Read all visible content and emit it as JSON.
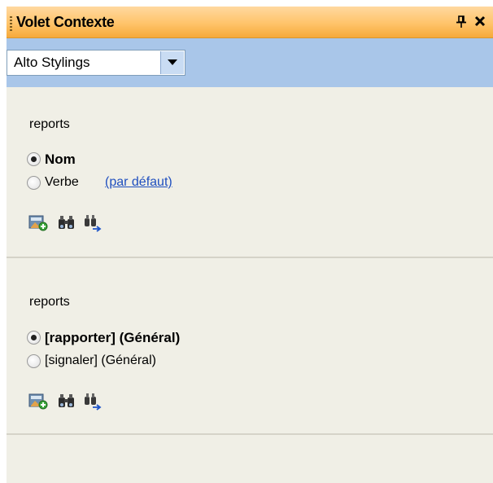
{
  "panel": {
    "title": "Volet Contexte",
    "pin_icon": "pin-icon",
    "close_icon": "close-icon"
  },
  "toolbar": {
    "dropdown_value": "Alto Stylings"
  },
  "sections": [
    {
      "word": "reports",
      "options": [
        {
          "label": "Nom",
          "selected": true
        },
        {
          "label": "Verbe",
          "selected": false,
          "link": "(par défaut)"
        }
      ],
      "icons": [
        "add-entry-icon",
        "binoculars-icon",
        "search-next-icon"
      ]
    },
    {
      "word": "reports",
      "options": [
        {
          "label": "[rapporter] (Général)",
          "selected": true
        },
        {
          "label": "[signaler] (Général)",
          "selected": false
        }
      ],
      "icons": [
        "add-entry-icon",
        "binoculars-icon",
        "search-next-icon"
      ]
    }
  ],
  "colors": {
    "title_bar": "#f6a93a",
    "toolbar": "#a9c6e9",
    "pane_bg": "#f0efe6",
    "link": "#1f4fbf"
  }
}
